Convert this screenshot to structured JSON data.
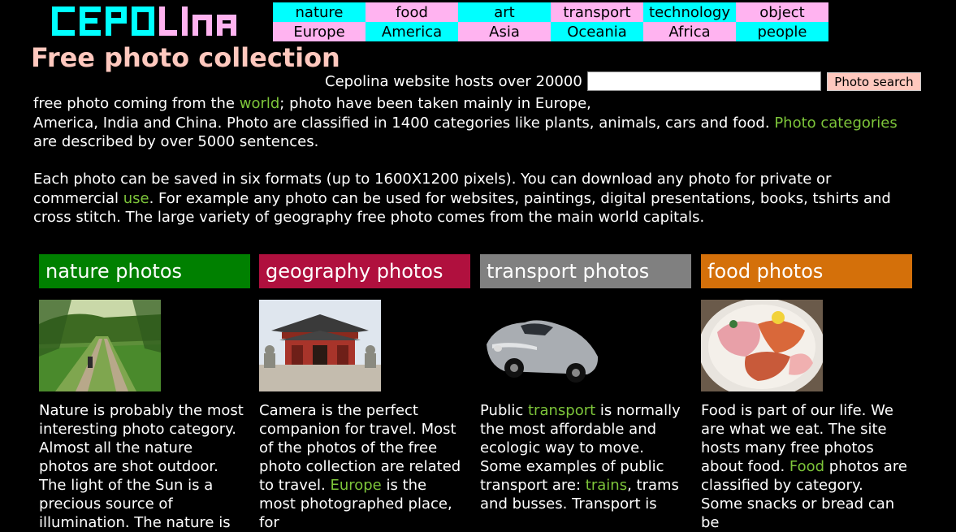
{
  "logo": "CEPOLINA",
  "nav": {
    "row1": [
      {
        "label": "nature",
        "color": "#00ffff"
      },
      {
        "label": "food",
        "color": "#ffb3f0"
      },
      {
        "label": "art",
        "color": "#00ffff"
      },
      {
        "label": "transport",
        "color": "#ffb3f0"
      },
      {
        "label": "technology",
        "color": "#00ffff"
      },
      {
        "label": "object",
        "color": "#ffb3f0"
      }
    ],
    "row2": [
      {
        "label": "Europe",
        "color": "#ffb3f0"
      },
      {
        "label": "America",
        "color": "#00ffff"
      },
      {
        "label": "Asia",
        "color": "#ffb3f0"
      },
      {
        "label": "Oceania",
        "color": "#00ffff"
      },
      {
        "label": "Africa",
        "color": "#ffb3f0"
      },
      {
        "label": "people",
        "color": "#00ffff"
      }
    ]
  },
  "title": "Free photo collection",
  "intro": {
    "line1": "Cepolina website hosts over 20000",
    "p1_a": "free photo coming from the ",
    "p1_link1": "world",
    "p1_b": "; photo have been taken mainly in Europe,",
    "p1_c": "America, India and China. Photo are classified in 1400 categories like plants, animals, cars and food. ",
    "p1_link2": "Photo categories",
    "p1_d": " are described by over 5000 sentences.",
    "p2_a": "Each photo can be saved in six formats (up to 1600X1200 pixels). You can download any photo for private or commercial ",
    "p2_link": "use",
    "p2_b": ". For example any photo can be used for websites, paintings, digital presentations, books, tshirts and cross stitch. The large variety of geography free photo comes from the main world capitals."
  },
  "search": {
    "value": "",
    "button": "Photo search"
  },
  "columns": [
    {
      "title": "nature photos",
      "color": "#008000",
      "image": "nature-path-photo",
      "text_a": "Nature is probably the most interesting photo category. Almost all the nature photos are shot outdoor. The light of the Sun is a precious source of illumination. The nature is"
    },
    {
      "title": "geography photos",
      "color": "#b0103e",
      "image": "chinese-temple-photo",
      "text_a": "Camera is the perfect companion for travel. Most of the photos of the free photo collection are related to travel. ",
      "link": "Europe",
      "text_b": " is the most photographed place, for"
    },
    {
      "title": "transport photos",
      "color": "#808080",
      "image": "vintage-car-photo",
      "text_a": "Public ",
      "link": "transport",
      "text_b": " is normally the most affordable and ecologic way to move. Some examples of public transport are: ",
      "link2": "trains",
      "text_c": ", trams and busses. Transport is"
    },
    {
      "title": "food photos",
      "color": "#d4700a",
      "image": "sushi-bowl-photo",
      "text_a": "Food is part of our life. We are what we eat. The site hosts many free photos about food. ",
      "link": "Food",
      "text_b": " photos are classified by category. Some snacks or bread can be"
    }
  ]
}
